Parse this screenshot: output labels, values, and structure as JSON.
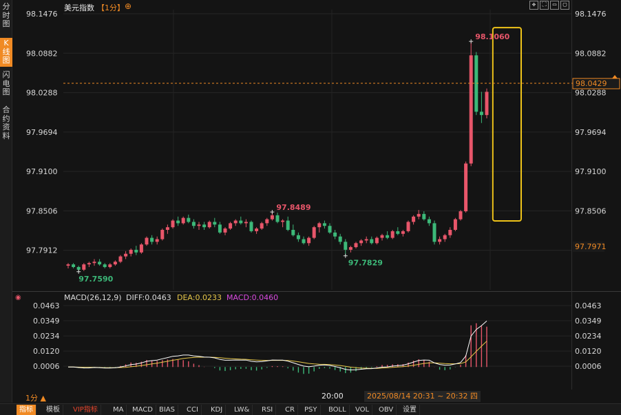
{
  "left_tabs": [
    {
      "label": "分\n时\n图",
      "active": false
    },
    {
      "label": "K\n线\n图",
      "active": true
    },
    {
      "label": "闪\n电\n图",
      "active": false
    },
    {
      "label": "合\n约\n资\n料",
      "active": false
    }
  ],
  "header": {
    "title": "美元指数",
    "period": "【1分】",
    "add_icon": "plus-circle-icon"
  },
  "window_controls": [
    {
      "name": "move-icon",
      "glyph": "✥"
    },
    {
      "name": "fullscreen-icon",
      "glyph": "⛶"
    },
    {
      "name": "minimize-icon",
      "glyph": "▭"
    },
    {
      "name": "close-icon",
      "glyph": "▢"
    }
  ],
  "price_axis": {
    "left_labels": [
      "98.1476",
      "98.0882",
      "98.0288",
      "97.9694",
      "97.9100",
      "97.8506",
      "97.7912"
    ],
    "right_labels": [
      "98.1476",
      "98.0882",
      "98.0288",
      "97.9694",
      "97.9100",
      "97.8506"
    ],
    "current_price": "98.0429",
    "low_marker": "97.7971"
  },
  "macd_header": {
    "params": "MACD(26,12,9)",
    "diff": "DIFF:0.0463",
    "dea": "DEA:0.0233",
    "macd": "MACD:0.0460"
  },
  "macd_axis_labels": [
    "0.0463",
    "0.0349",
    "0.0234",
    "0.0120",
    "0.0006"
  ],
  "footer": {
    "period": "1分 ▲",
    "time": "20:00",
    "range": "2025/08/14 20:31 ~ 20:32 四"
  },
  "bottom_tabs": [
    "指标",
    "模板",
    "VIP指标",
    "MA",
    "MACD",
    "BIAS",
    "CCI",
    "KDJ",
    "LW&",
    "RSI",
    "CR",
    "PSY",
    "BOLL",
    "VOL",
    "OBV",
    "设置"
  ],
  "colors": {
    "up": "#e8566a",
    "down": "#3cb878",
    "accent": "#f08a24",
    "highlight_box": "#f0c419",
    "diff": "#ffffff",
    "dea": "#e8c84a"
  },
  "chart_data": [
    {
      "type": "candlestick",
      "title": "美元指数",
      "ylim": [
        97.7318,
        98.1476
      ],
      "annotations": [
        {
          "text": "98.1060",
          "value": 98.106,
          "kind": "high"
        },
        {
          "text": "97.8489",
          "value": 97.8489,
          "kind": "local_high"
        },
        {
          "text": "97.7829",
          "value": 97.7829,
          "kind": "local_low"
        },
        {
          "text": "97.7590",
          "value": 97.759,
          "kind": "low"
        }
      ],
      "highlight_range": {
        "from_index": 83,
        "to_index": 88
      },
      "ohlc": [
        [
          97.768,
          97.772,
          97.764,
          97.77
        ],
        [
          97.77,
          97.772,
          97.764,
          97.766
        ],
        [
          97.766,
          97.768,
          97.759,
          97.762
        ],
        [
          97.762,
          97.772,
          97.76,
          97.77
        ],
        [
          97.77,
          97.774,
          97.766,
          97.772
        ],
        [
          97.772,
          97.778,
          97.768,
          97.774
        ],
        [
          97.774,
          97.778,
          97.768,
          97.77
        ],
        [
          97.77,
          97.772,
          97.764,
          97.766
        ],
        [
          97.766,
          97.772,
          97.764,
          97.77
        ],
        [
          97.77,
          97.776,
          97.768,
          97.774
        ],
        [
          97.774,
          97.784,
          97.772,
          97.782
        ],
        [
          97.782,
          97.79,
          97.778,
          97.786
        ],
        [
          97.786,
          97.794,
          97.782,
          97.792
        ],
        [
          97.792,
          97.798,
          97.784,
          97.788
        ],
        [
          97.788,
          97.802,
          97.786,
          97.8
        ],
        [
          97.8,
          97.812,
          97.798,
          97.81
        ],
        [
          97.81,
          97.814,
          97.8,
          97.804
        ],
        [
          97.804,
          97.812,
          97.8,
          97.808
        ],
        [
          97.808,
          97.824,
          97.806,
          97.822
        ],
        [
          97.822,
          97.83,
          97.816,
          97.826
        ],
        [
          97.826,
          97.838,
          97.824,
          97.836
        ],
        [
          97.836,
          97.842,
          97.828,
          97.832
        ],
        [
          97.832,
          97.842,
          97.83,
          97.84
        ],
        [
          97.84,
          97.845,
          97.832,
          97.834
        ],
        [
          97.834,
          97.838,
          97.824,
          97.828
        ],
        [
          97.828,
          97.834,
          97.822,
          97.83
        ],
        [
          97.83,
          97.834,
          97.822,
          97.826
        ],
        [
          97.826,
          97.836,
          97.824,
          97.834
        ],
        [
          97.834,
          97.84,
          97.826,
          97.83
        ],
        [
          97.83,
          97.834,
          97.816,
          97.818
        ],
        [
          97.818,
          97.826,
          97.814,
          97.824
        ],
        [
          97.824,
          97.834,
          97.822,
          97.832
        ],
        [
          97.832,
          97.838,
          97.828,
          97.836
        ],
        [
          97.836,
          97.842,
          97.83,
          97.832
        ],
        [
          97.832,
          97.838,
          97.826,
          97.834
        ],
        [
          97.834,
          97.836,
          97.818,
          97.82
        ],
        [
          97.82,
          97.826,
          97.816,
          97.824
        ],
        [
          97.824,
          97.834,
          97.822,
          97.832
        ],
        [
          97.832,
          97.84,
          97.828,
          97.838
        ],
        [
          97.838,
          97.849,
          97.836,
          97.844
        ],
        [
          97.844,
          97.848,
          97.832,
          97.834
        ],
        [
          97.834,
          97.838,
          97.826,
          97.836
        ],
        [
          97.836,
          97.842,
          97.82,
          97.822
        ],
        [
          97.822,
          97.83,
          97.812,
          97.814
        ],
        [
          97.814,
          97.818,
          97.804,
          97.808
        ],
        [
          97.808,
          97.812,
          97.8,
          97.802
        ],
        [
          97.802,
          97.812,
          97.798,
          97.81
        ],
        [
          97.81,
          97.828,
          97.808,
          97.826
        ],
        [
          97.826,
          97.834,
          97.818,
          97.832
        ],
        [
          97.832,
          97.836,
          97.824,
          97.828
        ],
        [
          97.828,
          97.832,
          97.816,
          97.818
        ],
        [
          97.818,
          97.822,
          97.808,
          97.812
        ],
        [
          97.812,
          97.816,
          97.8,
          97.804
        ],
        [
          97.804,
          97.808,
          97.783,
          97.792
        ],
        [
          97.792,
          97.798,
          97.788,
          97.796
        ],
        [
          97.796,
          97.804,
          97.794,
          97.802
        ],
        [
          97.802,
          97.808,
          97.798,
          97.806
        ],
        [
          97.806,
          97.812,
          97.802,
          97.808
        ],
        [
          97.808,
          97.812,
          97.8,
          97.802
        ],
        [
          97.802,
          97.812,
          97.8,
          97.81
        ],
        [
          97.81,
          97.816,
          97.806,
          97.814
        ],
        [
          97.814,
          97.82,
          97.808,
          97.81
        ],
        [
          97.81,
          97.822,
          97.808,
          97.82
        ],
        [
          97.82,
          97.826,
          97.814,
          97.816
        ],
        [
          97.816,
          97.822,
          97.812,
          97.82
        ],
        [
          97.82,
          97.836,
          97.818,
          97.834
        ],
        [
          97.834,
          97.844,
          97.83,
          97.842
        ],
        [
          97.842,
          97.852,
          97.838,
          97.846
        ],
        [
          97.846,
          97.85,
          97.836,
          97.838
        ],
        [
          97.838,
          97.842,
          97.828,
          97.832
        ],
        [
          97.832,
          97.836,
          97.8,
          97.804
        ],
        [
          97.804,
          97.812,
          97.8,
          97.808
        ],
        [
          97.808,
          97.816,
          97.804,
          97.814
        ],
        [
          97.814,
          97.826,
          97.81,
          97.822
        ],
        [
          97.822,
          97.84,
          97.82,
          97.838
        ],
        [
          97.838,
          97.852,
          97.836,
          97.85
        ],
        [
          97.85,
          97.925,
          97.848,
          97.922
        ],
        [
          97.922,
          98.106,
          97.918,
          98.085
        ],
        [
          98.085,
          98.09,
          97.995,
          98.0
        ],
        [
          98.0,
          98.03,
          97.983,
          97.995
        ],
        [
          97.995,
          98.035,
          97.99,
          98.03
        ]
      ]
    },
    {
      "type": "macd",
      "series": [
        {
          "name": "DIFF",
          "values": [
            0.0,
            0.0,
            -0.0004,
            -0.0007,
            -0.0007,
            -0.0004,
            -0.0005,
            -0.0008,
            -0.0008,
            -0.0006,
            -0.0,
            0.0008,
            0.0018,
            0.0022,
            0.0031,
            0.0043,
            0.0048,
            0.0052,
            0.0062,
            0.0071,
            0.0081,
            0.0084,
            0.009,
            0.009,
            0.0084,
            0.0081,
            0.0075,
            0.0074,
            0.0069,
            0.0057,
            0.0051,
            0.0051,
            0.0053,
            0.0052,
            0.0052,
            0.0043,
            0.0039,
            0.0041,
            0.0046,
            0.0053,
            0.0052,
            0.0052,
            0.0044,
            0.0032,
            0.0019,
            0.0007,
            0.0002,
            0.0007,
            0.0014,
            0.0016,
            0.0012,
            0.0004,
            -0.0006,
            -0.0018,
            -0.0022,
            -0.0021,
            -0.0017,
            -0.0013,
            -0.0012,
            -0.0007,
            -0.0001,
            0.0001,
            0.0007,
            0.001,
            0.0014,
            0.0024,
            0.0037,
            0.0049,
            0.0053,
            0.0051,
            0.0031,
            0.0019,
            0.0014,
            0.0015,
            0.0023,
            0.0034,
            0.0083,
            0.0234,
            0.0283,
            0.0312,
            0.0347
          ]
        },
        {
          "name": "DEA",
          "values": [
            0.0,
            0.0,
            -0.0001,
            -0.0002,
            -0.0003,
            -0.0003,
            -0.0004,
            -0.0005,
            -0.0005,
            -0.0005,
            -0.0004,
            -0.0002,
            0.0002,
            0.0006,
            0.0011,
            0.0017,
            0.0023,
            0.0029,
            0.0036,
            0.0043,
            0.0051,
            0.0057,
            0.0064,
            0.0069,
            0.0072,
            0.0074,
            0.0074,
            0.0074,
            0.0073,
            0.007,
            0.0066,
            0.0063,
            0.0061,
            0.0059,
            0.0058,
            0.0055,
            0.0052,
            0.005,
            0.0049,
            0.005,
            0.005,
            0.005,
            0.0049,
            0.0045,
            0.004,
            0.0033,
            0.0027,
            0.0023,
            0.0021,
            0.002,
            0.0018,
            0.0015,
            0.0011,
            0.0005,
            -0.0001,
            -0.0005,
            -0.0008,
            -0.0009,
            -0.001,
            -0.001,
            -0.0008,
            -0.0006,
            -0.0003,
            -0.0,
            0.0003,
            0.0007,
            0.0013,
            0.002,
            0.0027,
            0.0031,
            0.0031,
            0.0029,
            0.0026,
            0.0024,
            0.0024,
            0.0026,
            0.0038,
            0.0077,
            0.0118,
            0.0157,
            0.0195
          ]
        },
        {
          "name": "MACD",
          "values": [
            0.0,
            0.0,
            -0.0007,
            -0.001,
            -0.0009,
            -0.0003,
            -0.0003,
            -0.0007,
            -0.0006,
            -0.0002,
            0.0008,
            0.002,
            0.0034,
            0.0032,
            0.004,
            0.0053,
            0.005,
            0.0046,
            0.0052,
            0.0056,
            0.006,
            0.0055,
            0.0052,
            0.0043,
            0.0025,
            0.0014,
            0.0002,
            -0.0,
            -0.0008,
            -0.0026,
            -0.003,
            -0.0024,
            -0.0017,
            -0.0014,
            -0.0013,
            -0.0024,
            -0.0027,
            -0.0018,
            -0.0006,
            0.0007,
            0.0006,
            0.0005,
            -0.001,
            -0.0027,
            -0.0042,
            -0.0052,
            -0.005,
            -0.0033,
            -0.0014,
            -0.0008,
            -0.0012,
            -0.0023,
            -0.0034,
            -0.0046,
            -0.0042,
            -0.0032,
            -0.0018,
            -0.0008,
            -0.0005,
            0.0006,
            0.0015,
            0.0016,
            0.002,
            0.0021,
            0.0022,
            0.0034,
            0.0048,
            0.0058,
            0.0052,
            0.004,
            0.0001,
            -0.002,
            -0.0024,
            -0.0018,
            -0.0002,
            0.0016,
            0.009,
            0.0314,
            0.033,
            0.031,
            0.0304
          ]
        }
      ]
    }
  ]
}
